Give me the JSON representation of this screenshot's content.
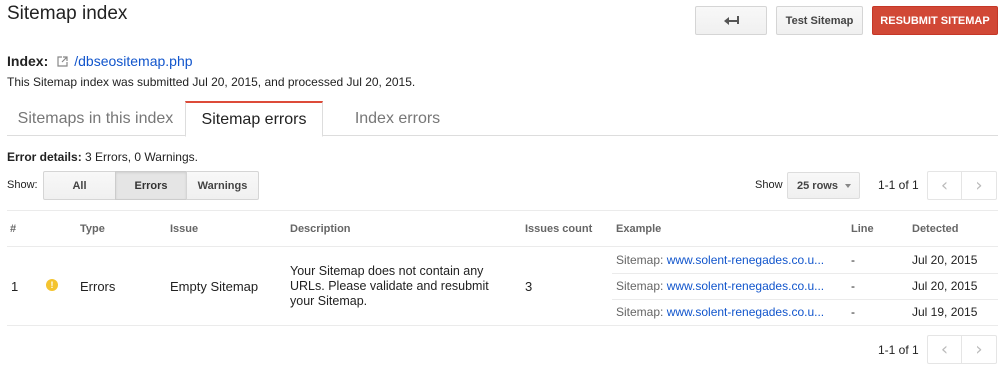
{
  "header": {
    "title": "Sitemap index",
    "test_label": "Test Sitemap",
    "resubmit_label": "RESUBMIT SITEMAP"
  },
  "index": {
    "label": "Index:",
    "link": "/dbseositemap.php",
    "submitted_text": "This Sitemap index was submitted Jul 20, 2015, and processed Jul 20, 2015."
  },
  "tabs": [
    {
      "label": "Sitemaps in this index",
      "active": false
    },
    {
      "label": "Sitemap errors",
      "active": true
    },
    {
      "label": "Index errors",
      "active": false
    }
  ],
  "error_details": {
    "label": "Error details:",
    "text": "3 Errors, 0 Warnings."
  },
  "filter": {
    "show_label": "Show:",
    "options": [
      "All",
      "Errors",
      "Warnings"
    ],
    "selected": "Errors"
  },
  "rows_select": {
    "label": "Show",
    "value": "25 rows"
  },
  "pager": {
    "range_top": "1-1 of 1",
    "range_bottom": "1-1 of 1"
  },
  "table": {
    "columns": [
      "#",
      "Type",
      "Issue",
      "Description",
      "Issues count",
      "Example",
      "Line",
      "Detected"
    ],
    "rows": [
      {
        "num": "1",
        "icon": "warning-icon",
        "type": "Errors",
        "issue": "Empty Sitemap",
        "description": "Your Sitemap does not contain any URLs. Please validate and resubmit your Sitemap.",
        "count": "3",
        "examples": [
          {
            "prefix": "Sitemap:",
            "url": "www.solent-renegades.co.u...",
            "line": "-",
            "detected": "Jul 20, 2015"
          },
          {
            "prefix": "Sitemap:",
            "url": "www.solent-renegades.co.u...",
            "line": "-",
            "detected": "Jul 20, 2015"
          },
          {
            "prefix": "Sitemap:",
            "url": "www.solent-renegades.co.u...",
            "line": "-",
            "detected": "Jul 19, 2015"
          }
        ]
      }
    ]
  },
  "colors": {
    "accent_red": "#d14836",
    "link_blue": "#1155cc",
    "warning_yellow": "#f4c430"
  }
}
